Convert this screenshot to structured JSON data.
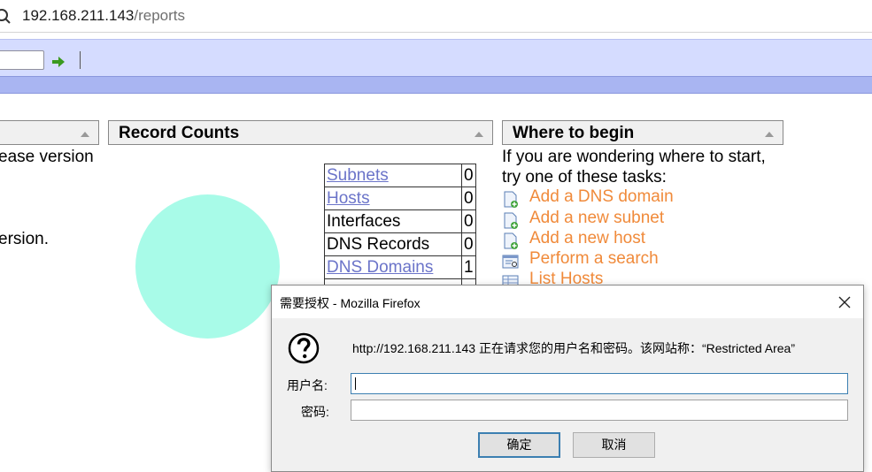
{
  "browser": {
    "url_host": "192.168.211.143",
    "url_path": "/reports",
    "icons": {
      "search": "search-icon"
    }
  },
  "toolbar": {
    "search_value": "",
    "icons": {
      "go": "green-arrow-right-icon"
    }
  },
  "panels": {
    "left": {
      "lines": [
        "ease version",
        "ersion."
      ]
    },
    "record_counts": {
      "title": "Record Counts",
      "circle_color": "#a8fbe8",
      "rows": [
        {
          "name": "Subnets",
          "count": "0",
          "link": true
        },
        {
          "name": "Hosts",
          "count": "0",
          "link": true
        },
        {
          "name": "Interfaces",
          "count": "0",
          "link": false
        },
        {
          "name": "DNS Records",
          "count": "0",
          "link": false
        },
        {
          "name": "DNS Domains",
          "count": "1",
          "link": true
        }
      ]
    },
    "where_to_begin": {
      "title": "Where to begin",
      "intro_line1": "If you are wondering where to start,",
      "intro_line2": "try one of these tasks:",
      "tasks": [
        {
          "label": "Add a DNS domain",
          "icon": "add-page-icon"
        },
        {
          "label": "Add a new subnet",
          "icon": "add-page-icon"
        },
        {
          "label": "Add a new host",
          "icon": "add-page-icon"
        },
        {
          "label": "Perform a search",
          "icon": "search-form-icon"
        },
        {
          "label": "List Hosts",
          "icon": "list-table-icon"
        }
      ],
      "task_color": "#f08a3a"
    }
  },
  "auth_dialog": {
    "title": "需要授权 - Mozilla Firefox",
    "message": "http://192.168.211.143 正在请求您的用户名和密码。该网站称：“Restricted Area”",
    "username_label": "用户名:",
    "password_label": "密码:",
    "username_value": "",
    "password_value": "",
    "ok_label": "确定",
    "cancel_label": "取消",
    "icons": {
      "question": "question-mark-icon",
      "close": "close-icon"
    }
  }
}
